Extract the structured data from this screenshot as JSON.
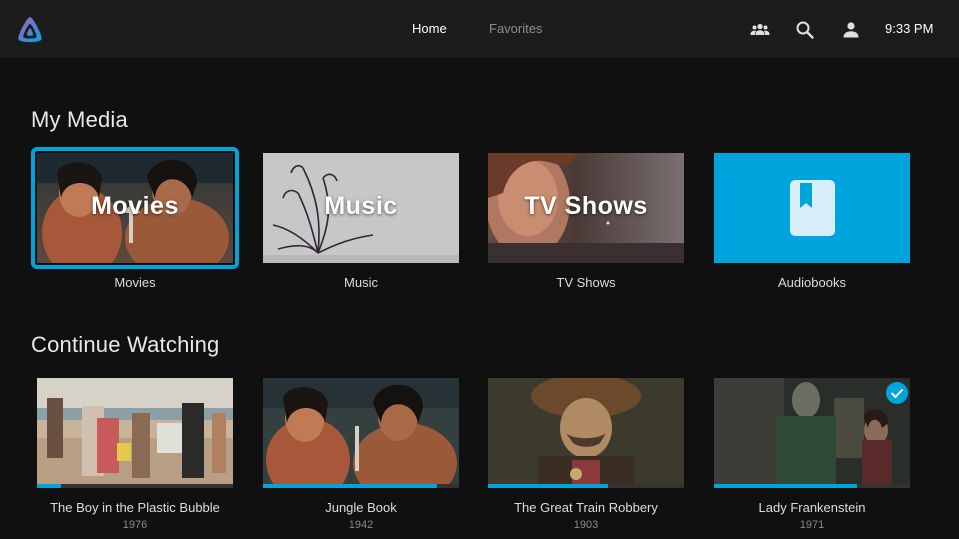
{
  "header": {
    "logo_icon": "jellyfin-logo-icon",
    "tabs": [
      {
        "label": "Home",
        "active": true
      },
      {
        "label": "Favorites",
        "active": false
      }
    ],
    "icons": [
      "users-icon",
      "search-icon",
      "user-icon"
    ],
    "time": "9:33 PM"
  },
  "my_media": {
    "title": "My Media",
    "items": [
      {
        "overlay": "Movies",
        "label": "Movies",
        "focused": true
      },
      {
        "overlay": "Music",
        "label": "Music",
        "focused": false
      },
      {
        "overlay": "TV Shows",
        "label": "TV Shows",
        "focused": false
      },
      {
        "overlay": "",
        "label": "Audiobooks",
        "focused": false,
        "icon": "book-icon"
      }
    ]
  },
  "continue_watching": {
    "title": "Continue Watching",
    "items": [
      {
        "title": "The Boy in the Plastic Bubble",
        "year": "1976",
        "progress": 0.12,
        "played": false
      },
      {
        "title": "Jungle Book",
        "year": "1942",
        "progress": 0.89,
        "played": false
      },
      {
        "title": "The Great Train Robbery",
        "year": "1903",
        "progress": 0.61,
        "played": false
      },
      {
        "title": "Lady Frankenstein",
        "year": "1971",
        "progress": 0.73,
        "played": true
      }
    ]
  },
  "colors": {
    "accent": "#00a4dc",
    "background": "#101010",
    "header": "#1c1c1c"
  }
}
